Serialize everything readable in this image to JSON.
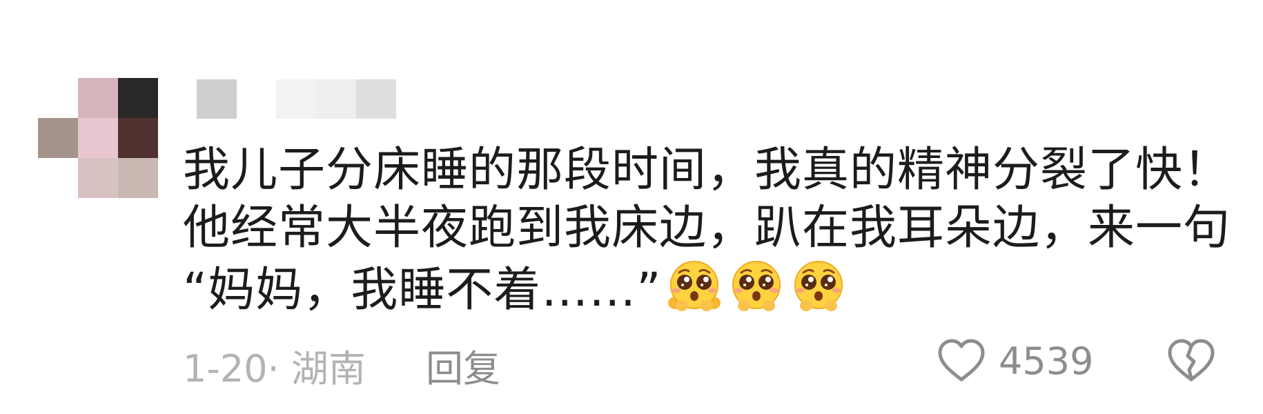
{
  "comment": {
    "lines": [
      "我儿子分床睡的那段时间，我真的精神分裂了快！",
      "他经常大半夜跑到我床边，趴在我耳朵边，来一句",
      "“妈妈，我睡不着……”"
    ],
    "emojis": [
      "pleading-face-icon",
      "pleading-face-icon",
      "pleading-face-icon"
    ]
  },
  "meta": {
    "date_location": "1-20· 湖南",
    "reply_label": "回复",
    "like_count": "4539"
  },
  "colors": {
    "text": "#1c1c1c",
    "meta": "#b3b3b3",
    "action": "#8d8d8d"
  }
}
